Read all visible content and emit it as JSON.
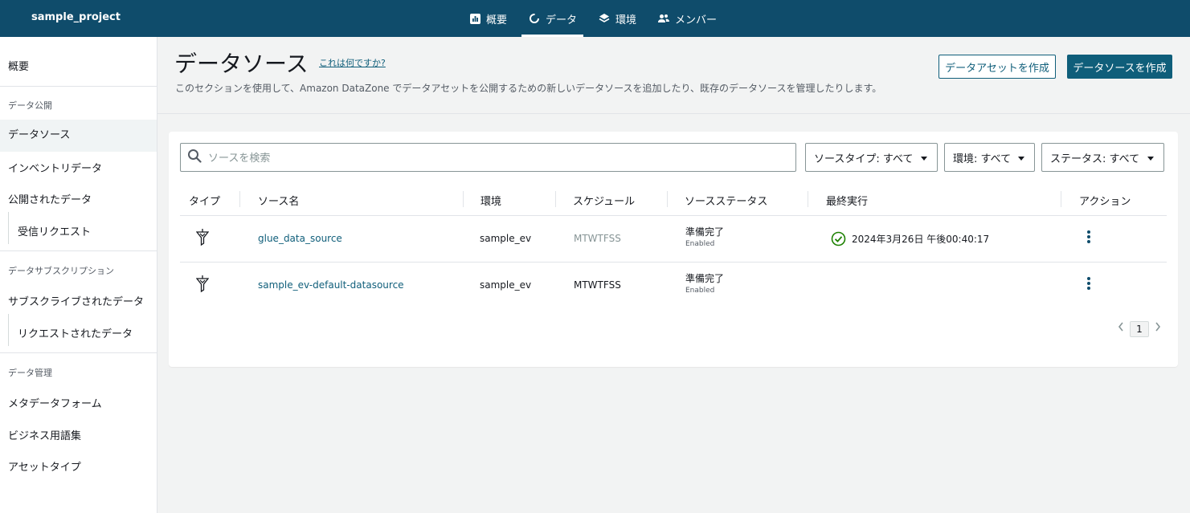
{
  "topbar": {
    "project": "sample_project",
    "tabs": [
      {
        "label": "概要",
        "icon": "bar-chart-icon"
      },
      {
        "label": "データ",
        "icon": "data-ring-icon",
        "active": true
      },
      {
        "label": "環境",
        "icon": "layers-icon"
      },
      {
        "label": "メンバー",
        "icon": "users-icon"
      }
    ]
  },
  "sidebar": {
    "overview": "概要",
    "section_publish": "データ公開",
    "items_publish": [
      "データソース",
      "インベントリデータ",
      "公開されたデータ",
      "受信リクエスト"
    ],
    "section_subscribe": "データサブスクリプション",
    "items_subscribe": [
      "サブスクライブされたデータ",
      "リクエストされたデータ"
    ],
    "section_manage": "データ管理",
    "items_manage": [
      "メタデータフォーム",
      "ビジネス用語集",
      "アセットタイプ"
    ]
  },
  "header": {
    "title": "データソース",
    "help": "これは何ですか?",
    "description": "このセクションを使用して、Amazon DataZone でデータアセットを公開するための新しいデータソースを追加したり、既存のデータソースを管理したりします。",
    "btn_create_asset": "データアセットを作成",
    "btn_create_source": "データソースを作成"
  },
  "toolbar": {
    "search_placeholder": "ソースを検索",
    "filter_type": "ソースタイプ: すべて",
    "filter_env": "環境: すべて",
    "filter_status": "ステータス: すべて"
  },
  "table": {
    "columns": [
      "タイプ",
      "ソース名",
      "環境",
      "スケジュール",
      "ソースステータス",
      "最終実行",
      "アクション"
    ],
    "rows": [
      {
        "name": "glue_data_source",
        "env": "sample_ev",
        "schedule": "MTWTFSS",
        "status": "準備完了",
        "status_sub": "Enabled",
        "last_run": "2024年3月26日 午後00:40:17"
      },
      {
        "name": "sample_ev-default-datasource",
        "env": "sample_ev",
        "schedule": "MTWTFSS",
        "status": "準備完了",
        "status_sub": "Enabled",
        "last_run": ""
      }
    ]
  },
  "pagination": {
    "current": "1"
  },
  "colors": {
    "topbar": "#0f4c6b",
    "accent": "#0f5e7a",
    "success": "#1d8102"
  }
}
